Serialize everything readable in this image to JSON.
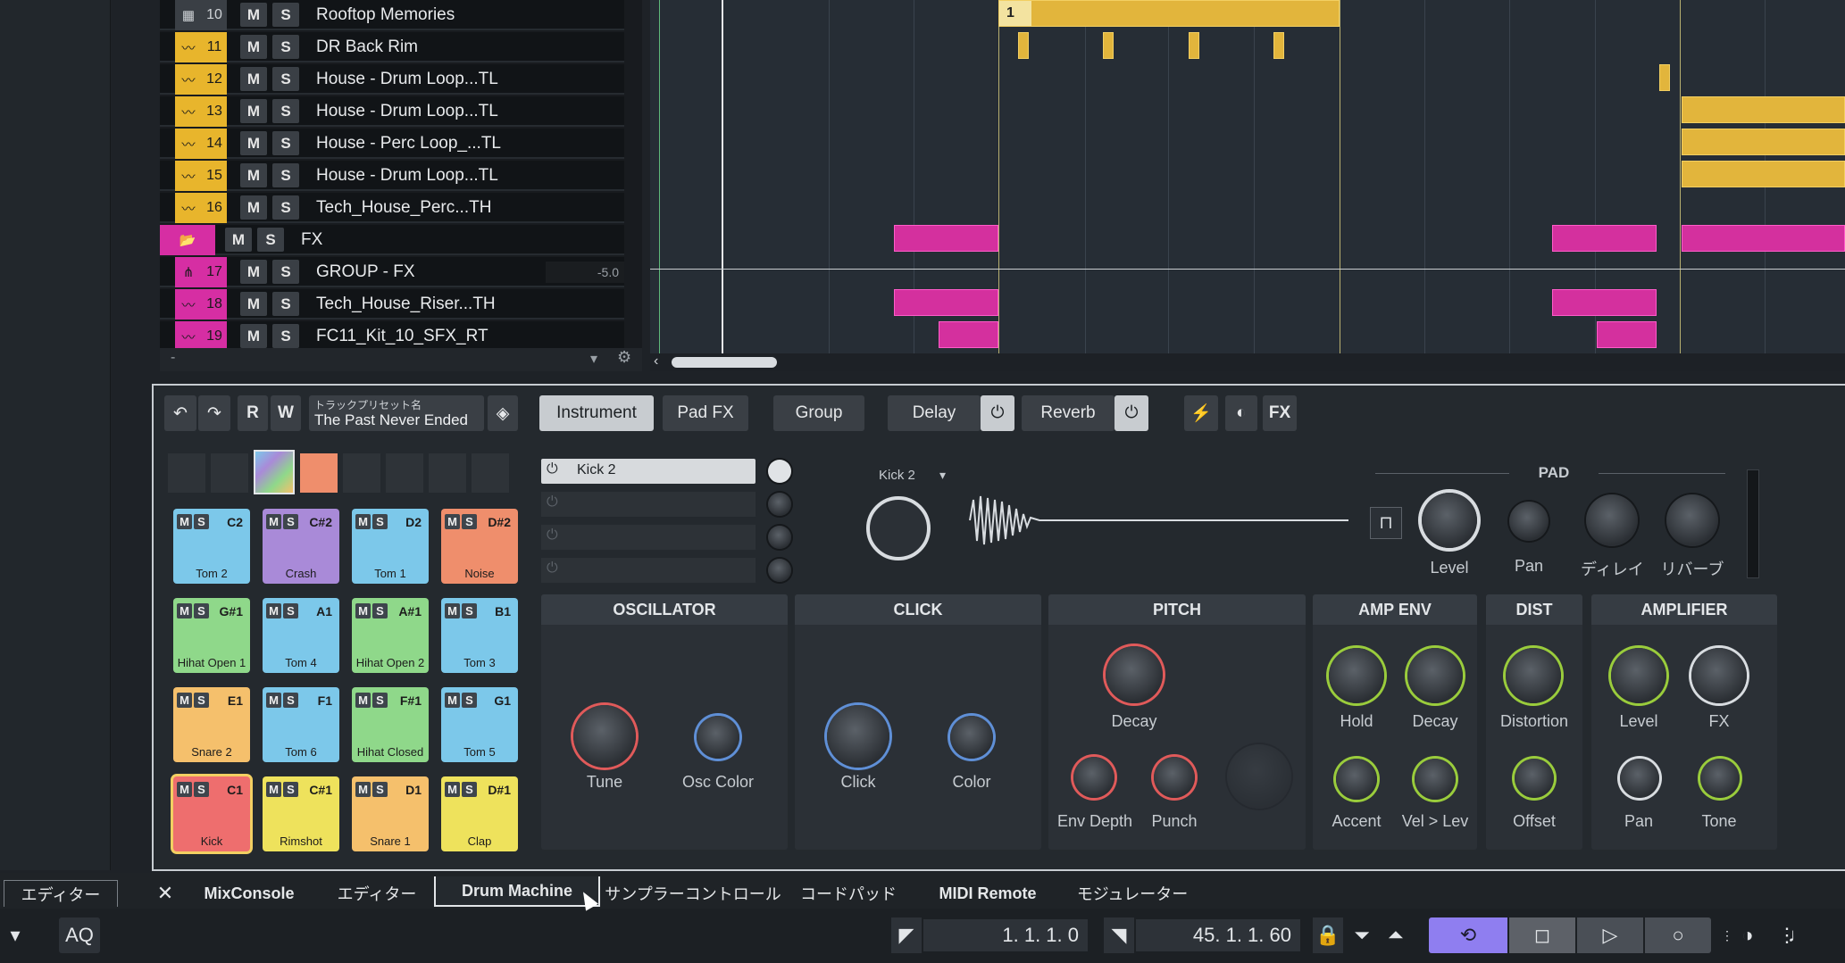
{
  "tracks": [
    {
      "num": "10",
      "name": "Rooftop Memories",
      "icon": "grid-icon",
      "color": "#9aa0a6"
    },
    {
      "num": "11",
      "name": "DR Back Rim",
      "icon": "waveform-icon",
      "color": "#e8b52c"
    },
    {
      "num": "12",
      "name": "House - Drum Loop...TL",
      "icon": "waveform-icon",
      "color": "#e8b52c"
    },
    {
      "num": "13",
      "name": "House - Drum Loop...TL",
      "icon": "waveform-icon",
      "color": "#e8b52c"
    },
    {
      "num": "14",
      "name": "House - Perc Loop_...TL",
      "icon": "waveform-icon",
      "color": "#e8b52c"
    },
    {
      "num": "15",
      "name": "House - Drum Loop...TL",
      "icon": "waveform-icon",
      "color": "#e8b52c"
    },
    {
      "num": "16",
      "name": "Tech_House_Perc...TH",
      "icon": "waveform-icon",
      "color": "#e8b52c"
    },
    {
      "num": "",
      "name": "FX",
      "icon": "folder-icon",
      "color": "#d62ea3"
    },
    {
      "num": "17",
      "name": "GROUP - FX",
      "icon": "group-icon",
      "color": "#d62ea3",
      "volume": "-5.0"
    },
    {
      "num": "18",
      "name": "Tech_House_Riser...TH",
      "icon": "waveform-icon",
      "color": "#d62ea3"
    },
    {
      "num": "19",
      "name": "FC11_Kit_10_SFX_RT",
      "icon": "waveform-icon",
      "color": "#d62ea3"
    }
  ],
  "mute_label": "M",
  "solo_label": "S",
  "tracklist_footer": "-",
  "arrangement": {
    "region_label": "1"
  },
  "toolbar": {
    "preset_caption": "トラックプリセット名",
    "preset_name": "The Past Never Ended",
    "r_label": "R",
    "w_label": "W",
    "instrument": "Instrument",
    "padfx": "Pad FX",
    "group": "Group",
    "delay": "Delay",
    "reverb": "Reverb",
    "fx": "FX"
  },
  "pads": [
    {
      "note": "C2",
      "label": "Tom 2",
      "color": "#7cc8ea"
    },
    {
      "note": "C#2",
      "label": "Crash",
      "color": "#a98ad8"
    },
    {
      "note": "D2",
      "label": "Tom 1",
      "color": "#7cc8ea"
    },
    {
      "note": "D#2",
      "label": "Noise",
      "color": "#ef8e6c"
    },
    {
      "note": "G#1",
      "label": "Hihat Open 1",
      "color": "#8fd88a"
    },
    {
      "note": "A1",
      "label": "Tom 4",
      "color": "#7cc8ea"
    },
    {
      "note": "A#1",
      "label": "Hihat Open 2",
      "color": "#8fd88a"
    },
    {
      "note": "B1",
      "label": "Tom 3",
      "color": "#7cc8ea"
    },
    {
      "note": "E1",
      "label": "Snare 2",
      "color": "#f5c06c"
    },
    {
      "note": "F1",
      "label": "Tom 6",
      "color": "#7cc8ea"
    },
    {
      "note": "F#1",
      "label": "Hihat Closed",
      "color": "#8fd88a"
    },
    {
      "note": "G1",
      "label": "Tom 5",
      "color": "#7cc8ea"
    },
    {
      "note": "C1",
      "label": "Kick",
      "color": "#ee6e6e"
    },
    {
      "note": "C#1",
      "label": "Rimshot",
      "color": "#eee25c"
    },
    {
      "note": "D1",
      "label": "Snare 1",
      "color": "#f5c06c"
    },
    {
      "note": "D#1",
      "label": "Clap",
      "color": "#eee25c"
    }
  ],
  "layer": {
    "name": "Kick 2",
    "selector": "Kick 2"
  },
  "pad_section": {
    "title": "PAD",
    "knobs": [
      {
        "label": "Level"
      },
      {
        "label": "Pan"
      },
      {
        "label": "ディレイ"
      },
      {
        "label": "リバーブ"
      }
    ]
  },
  "sections": {
    "oscillator": {
      "title": "OSCILLATOR",
      "knobs": [
        "Tune",
        "Osc Color"
      ]
    },
    "click": {
      "title": "CLICK",
      "knobs": [
        "Click",
        "Color"
      ]
    },
    "pitch": {
      "title": "PITCH",
      "knobs": [
        "Decay",
        "Env Depth",
        "Punch"
      ]
    },
    "ampenv": {
      "title": "AMP ENV",
      "knobs": [
        "Hold",
        "Decay",
        "Accent",
        "Vel > Lev"
      ]
    },
    "dist": {
      "title": "DIST",
      "knobs": [
        "Distortion",
        "Offset"
      ]
    },
    "amplifier": {
      "title": "AMPLIFIER",
      "knobs": [
        "Level",
        "FX",
        "Pan",
        "Tone"
      ]
    }
  },
  "tabs": [
    "エディター",
    "MixConsole",
    "エディター",
    "Drum Machine",
    "サンプラーコントロール",
    "コードパッド",
    "MIDI Remote",
    "モジュレーター"
  ],
  "transport": {
    "aq": "AQ",
    "left_locator": "1. 1. 1.   0",
    "right_locator": "45. 1. 1. 60"
  }
}
